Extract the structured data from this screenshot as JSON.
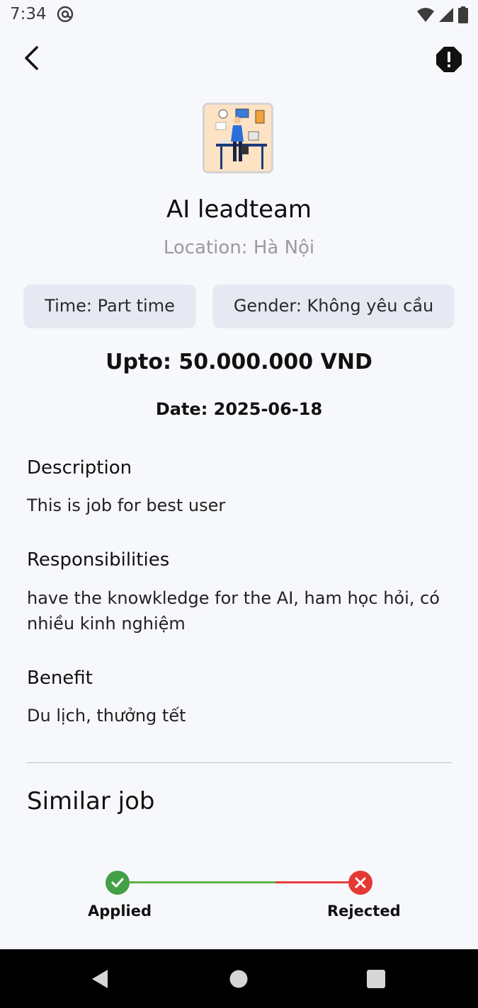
{
  "status_bar": {
    "time": "7:34"
  },
  "job": {
    "title": "AI leadteam",
    "location": "Location: Hà Nội",
    "time_chip": "Time: Part time",
    "gender_chip": "Gender: Không yêu cầu",
    "salary": "Upto: 50.000.000 VND",
    "date": "Date: 2025-06-18"
  },
  "sections": {
    "description": {
      "heading": "Description",
      "text": "This is job for best user"
    },
    "responsibilities": {
      "heading": "Responsibilities",
      "text": "have the knowkledge for the AI, ham học hỏi, có nhiều kinh nghiệm"
    },
    "benefit": {
      "heading": "Benefit",
      "text": "Du lịch, thưởng tết"
    }
  },
  "similar": {
    "heading": "Similar job"
  },
  "progress": {
    "steps": [
      {
        "label": "Applied",
        "status": "done",
        "color": "#43a047"
      },
      {
        "label": "Rejected",
        "status": "rejected",
        "color": "#e53935"
      }
    ]
  },
  "icons": {
    "back": "arrow-left-icon",
    "report": "alert-octagon-icon",
    "nav_back": "triangle-back-icon",
    "nav_home": "circle-home-icon",
    "nav_recent": "square-recents-icon"
  }
}
